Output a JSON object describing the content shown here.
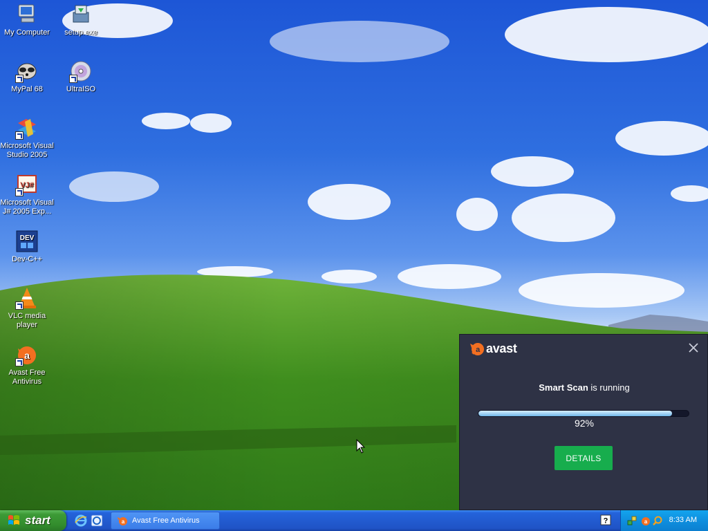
{
  "desktop": {
    "icons": [
      {
        "label": "My Computer",
        "icon": "my-computer-icon"
      },
      {
        "label": "setup.exe",
        "icon": "setup-exe-icon"
      },
      {
        "label": "MyPal 68",
        "icon": "mypal-icon"
      },
      {
        "label": "UltraISO",
        "icon": "ultraiso-icon"
      },
      {
        "label": "Microsoft Visual Studio 2005",
        "icon": "visual-studio-icon"
      },
      {
        "label": "Microsoft Visual J# 2005 Exp...",
        "icon": "visual-jsharp-icon"
      },
      {
        "label": "Dev-C++",
        "icon": "dev-cpp-icon"
      },
      {
        "label": "VLC media player",
        "icon": "vlc-icon"
      },
      {
        "label": "Avast Free Antivirus",
        "icon": "avast-icon"
      }
    ]
  },
  "avast_popup": {
    "brand": "avast",
    "title_strong": "Smart Scan",
    "title_rest": " is running",
    "progress_percent": 92,
    "progress_label": "92%",
    "details_label": "DETAILS",
    "accent": "#17ad4d",
    "logo_color": "#f36f21"
  },
  "taskbar": {
    "start_label": "start",
    "quick_launch": [
      "internet-explorer-icon",
      "ie-refresh-icon"
    ],
    "active_task": "Avast Free Antivirus",
    "clock": "8:33 AM",
    "tray_icons": [
      "network-icon",
      "avast-tray-icon",
      "search-tray-icon"
    ]
  }
}
